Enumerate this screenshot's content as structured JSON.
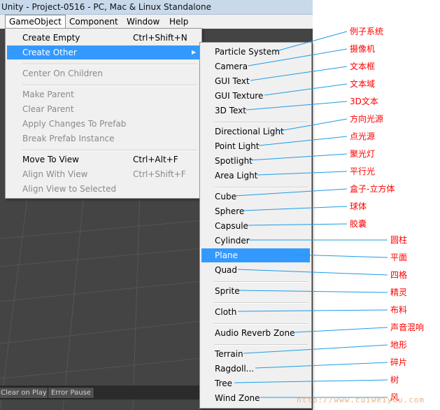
{
  "title": "Unity - Project-0516 - PC, Mac & Linux Standalone",
  "menubar": [
    "GameObject",
    "Component",
    "Window",
    "Help"
  ],
  "status_buttons": [
    "Clear on Play",
    "Error Pause"
  ],
  "gameobject_menu": [
    {
      "label": "Create Empty",
      "shortcut": "Ctrl+Shift+N",
      "enabled": true
    },
    {
      "label": "Create Other",
      "shortcut": "",
      "submenu": true,
      "highlighted": true,
      "enabled": true
    },
    {
      "label": "Center On Children",
      "shortcut": "",
      "enabled": false
    },
    {
      "label": "Make Parent",
      "shortcut": "",
      "enabled": false
    },
    {
      "label": "Clear Parent",
      "shortcut": "",
      "enabled": false
    },
    {
      "label": "Apply Changes To Prefab",
      "shortcut": "",
      "enabled": false
    },
    {
      "label": "Break Prefab Instance",
      "shortcut": "",
      "enabled": false
    },
    {
      "label": "Move To View",
      "shortcut": "Ctrl+Alt+F",
      "enabled": true
    },
    {
      "label": "Align With View",
      "shortcut": "Ctrl+Shift+F",
      "enabled": false
    },
    {
      "label": "Align View to Selected",
      "shortcut": "",
      "enabled": false
    }
  ],
  "submenu_arrow": "▶",
  "create_other_menu": [
    {
      "label": "Particle System",
      "annotation": "例子系统"
    },
    {
      "label": "Camera",
      "annotation": "摄像机"
    },
    {
      "label": "GUI Text",
      "annotation": "文本框"
    },
    {
      "label": "GUI Texture",
      "annotation": "文本域"
    },
    {
      "label": "3D Text",
      "annotation": "3D文本"
    },
    {
      "label": "Directional Light",
      "annotation": "方向光源"
    },
    {
      "label": "Point Light",
      "annotation": "点光源"
    },
    {
      "label": "Spotlight",
      "annotation": "聚光灯"
    },
    {
      "label": "Area Light",
      "annotation": "平行光"
    },
    {
      "label": "Cube",
      "annotation": "盒子-立方体"
    },
    {
      "label": "Sphere",
      "annotation": "球体"
    },
    {
      "label": "Capsule",
      "annotation": "胶囊"
    },
    {
      "label": "Cylinder",
      "annotation": "圆柱"
    },
    {
      "label": "Plane",
      "annotation": "平面",
      "highlighted": true
    },
    {
      "label": "Quad",
      "annotation": "四格"
    },
    {
      "label": "Sprite",
      "annotation": "精灵"
    },
    {
      "label": "Cloth",
      "annotation": "布料"
    },
    {
      "label": "Audio Reverb Zone",
      "annotation": "声音混响"
    },
    {
      "label": "Terrain",
      "annotation": "地形"
    },
    {
      "label": "Ragdoll...",
      "annotation": "碎片"
    },
    {
      "label": "Tree",
      "annotation": "树"
    },
    {
      "label": "Wind Zone",
      "annotation": "风"
    }
  ],
  "watermark": "http://www.cuiweiyou.com",
  "colors": {
    "highlight": "#3399ff",
    "annotation": "#ff0000",
    "leader_line": "#1e9be6"
  }
}
